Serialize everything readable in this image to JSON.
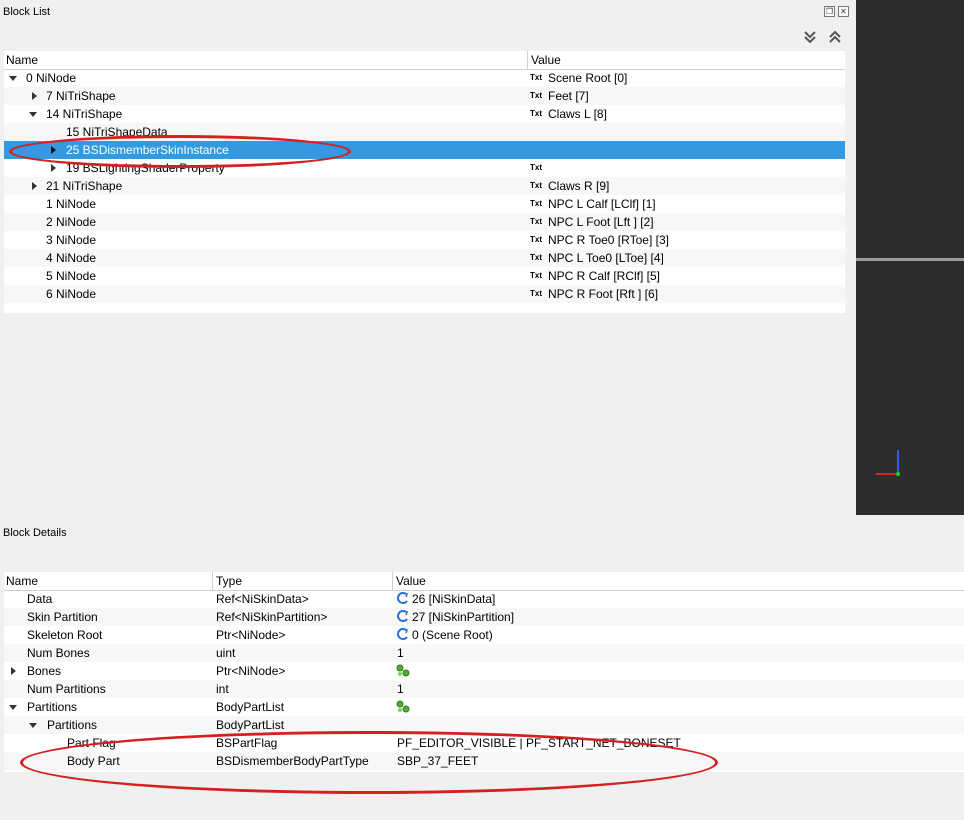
{
  "block_list": {
    "title": "Block List",
    "columns": {
      "name": "Name",
      "value": "Value"
    },
    "rows": [
      {
        "name": "0 NiNode",
        "value": "Scene Root [0]"
      },
      {
        "name": "7 NiTriShape",
        "value": "Feet [7]"
      },
      {
        "name": "14 NiTriShape",
        "value": "Claws L [8]"
      },
      {
        "name": "15 NiTriShapeData",
        "value": ""
      },
      {
        "name": "25 BSDismemberSkinInstance",
        "value": ""
      },
      {
        "name": "19 BSLightingShaderProperty",
        "value": ""
      },
      {
        "name": "21 NiTriShape",
        "value": "Claws R [9]"
      },
      {
        "name": "1 NiNode",
        "value": "NPC L Calf [LClf] [1]"
      },
      {
        "name": "2 NiNode",
        "value": "NPC L Foot [Lft ] [2]"
      },
      {
        "name": "3 NiNode",
        "value": "NPC R Toe0 [RToe] [3]"
      },
      {
        "name": "4 NiNode",
        "value": "NPC L Toe0 [LToe] [4]"
      },
      {
        "name": "5 NiNode",
        "value": "NPC R Calf [RClf] [5]"
      },
      {
        "name": "6 NiNode",
        "value": "NPC R Foot [Rft ] [6]"
      }
    ],
    "txt_label": "Txt",
    "selected_row": "25 BSDismemberSkinInstance"
  },
  "block_details": {
    "title": "Block Details",
    "columns": {
      "name": "Name",
      "type": "Type",
      "value": "Value"
    },
    "rows": [
      {
        "name": "Data",
        "type": "Ref<NiSkinData>",
        "value": "26 [NiSkinData]"
      },
      {
        "name": "Skin Partition",
        "type": "Ref<NiSkinPartition>",
        "value": "27 [NiSkinPartition]"
      },
      {
        "name": "Skeleton Root",
        "type": "Ptr<NiNode>",
        "value": "0 (Scene Root)"
      },
      {
        "name": "Num Bones",
        "type": "uint",
        "value": "1"
      },
      {
        "name": "Bones",
        "type": "Ptr<NiNode>",
        "value": ""
      },
      {
        "name": "Num Partitions",
        "type": "int",
        "value": "1"
      },
      {
        "name": "Partitions",
        "type": "BodyPartList",
        "value": ""
      },
      {
        "name": "Partitions",
        "type": "BodyPartList",
        "value": ""
      },
      {
        "name": "Part Flag",
        "type": "BSPartFlag",
        "value": "PF_EDITOR_VISIBLE | PF_START_NET_BONESET"
      },
      {
        "name": "Body Part",
        "type": "BSDismemberBodyPartType",
        "value": "SBP_37_FEET"
      }
    ]
  },
  "colors": {
    "selection": "#3399e0",
    "annotation": "#d42020"
  }
}
